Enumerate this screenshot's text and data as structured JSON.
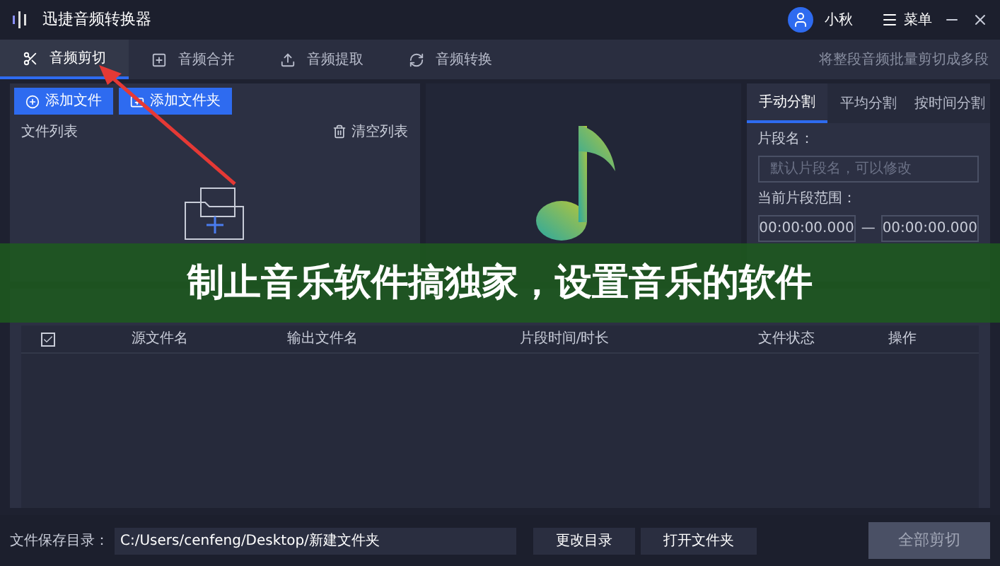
{
  "window": {
    "title": "迅捷音频转换器",
    "user": "小秋",
    "menu": "菜单"
  },
  "tabs": [
    {
      "label": "音频剪切",
      "selected": true,
      "kind": "cut"
    },
    {
      "label": "音频合并",
      "selected": false,
      "kind": "merge"
    },
    {
      "label": "音频提取",
      "selected": false,
      "kind": "extract"
    },
    {
      "label": "音频转换",
      "selected": false,
      "kind": "convert"
    }
  ],
  "hint": "将整段音频批量剪切成多段",
  "file_panel": {
    "buttons": [
      {
        "label": "添加文件",
        "kind": "file"
      },
      {
        "label": "添加文件夹",
        "kind": "folder"
      }
    ],
    "title": "文件列表",
    "clear": "清空列表"
  },
  "split_tabs": [
    {
      "label": "手动分割",
      "selected": true
    },
    {
      "label": "平均分割",
      "selected": false
    },
    {
      "label": "按时间分割",
      "selected": false
    }
  ],
  "split_form": {
    "name_label": "片段名：",
    "name_placeholder": "默认片段名，可以修改",
    "range_label": "当前片段范围：",
    "start": "00:00:00.000",
    "dash": "—",
    "end": "00:00:00.000"
  },
  "output": {
    "columns": [
      "源文件名",
      "输出文件名",
      "片段时间/时长",
      "文件状态",
      "操作"
    ],
    "all_checked": true
  },
  "footer": {
    "label": "文件保存目录：",
    "path": "C:/Users/cenfeng/Desktop/新建文件夹",
    "change": "更改目录",
    "open": "打开文件夹",
    "run": "全部剪切",
    "run_disabled": true
  },
  "banner": {
    "text": "制止音乐软件搞独家，设置音乐的软件"
  }
}
